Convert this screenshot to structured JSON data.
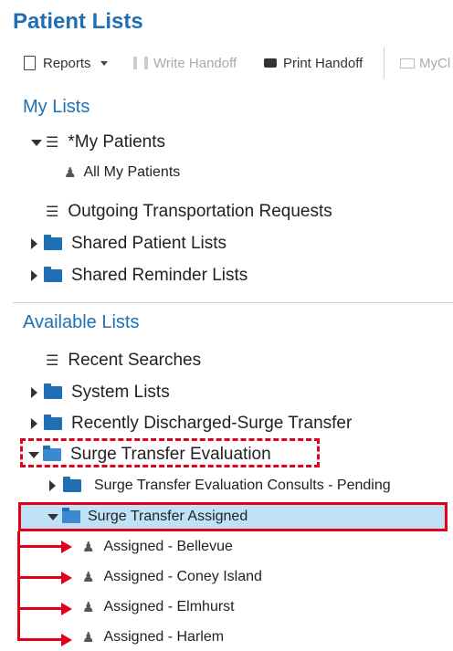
{
  "header": {
    "title": "Patient Lists"
  },
  "toolbar": {
    "reports": "Reports",
    "write_handoff": "Write Handoff",
    "print_handoff": "Print Handoff",
    "mycl": "MyCl"
  },
  "my_lists": {
    "title": "My Lists",
    "my_patients": "*My Patients",
    "all_my_patients": "All My Patients",
    "outgoing": "Outgoing Transportation Requests",
    "shared_patient": "Shared Patient Lists",
    "shared_reminder": "Shared Reminder Lists"
  },
  "available_lists": {
    "title": "Available Lists",
    "recent_searches": "Recent Searches",
    "system_lists": "System Lists",
    "recently_discharged": "Recently Discharged-Surge Transfer",
    "surge_eval": "Surge Transfer Evaluation",
    "surge_eval_consults": "Surge Transfer Evaluation Consults - Pending",
    "surge_assigned": "Surge Transfer Assigned",
    "assigned": [
      "Assigned - Bellevue",
      "Assigned - Coney Island",
      "Assigned - Elmhurst",
      "Assigned - Harlem"
    ]
  },
  "colors": {
    "accent": "#1f6fb5",
    "highlight": "#bfe2f6",
    "annotation_red": "#e0001b"
  }
}
